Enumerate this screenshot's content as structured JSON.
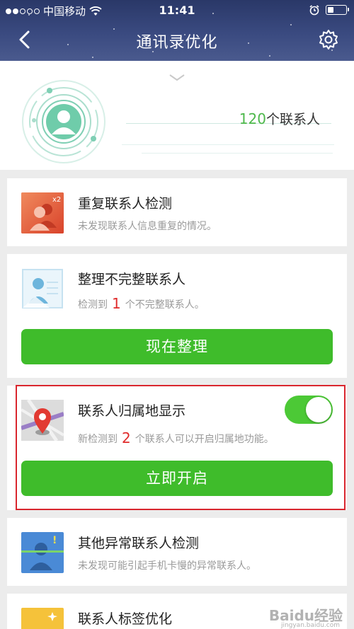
{
  "statusbar": {
    "carrier": "中国移动",
    "time": "11:41"
  },
  "navbar": {
    "title": "通讯录优化"
  },
  "summary": {
    "count": "120",
    "count_suffix": "个联系人"
  },
  "cards": [
    {
      "title": "重复联系人检测",
      "desc": "未发现联系人信息重复的情况。",
      "badge": "x2"
    },
    {
      "title": "整理不完整联系人",
      "desc_prefix": "检测到",
      "desc_number": "1",
      "desc_suffix": "个不完整联系人。",
      "button": "现在整理"
    },
    {
      "title": "联系人归属地显示",
      "desc_prefix": "新检测到",
      "desc_number": "2",
      "desc_suffix": "个联系人可以开启归属地功能。",
      "button": "立即开启",
      "toggle_on": true
    },
    {
      "title": "其他异常联系人检测",
      "desc": "未发现可能引起手机卡慢的异常联系人。"
    },
    {
      "title": "联系人标签优化"
    }
  ],
  "watermark": {
    "text": "Baidu经验",
    "sub": "jingyan.baidu.com"
  },
  "colors": {
    "accent_green": "#3fbc2b",
    "highlight_red": "#d9262e",
    "number_red": "#e02b2b",
    "count_green": "#4db84b"
  }
}
